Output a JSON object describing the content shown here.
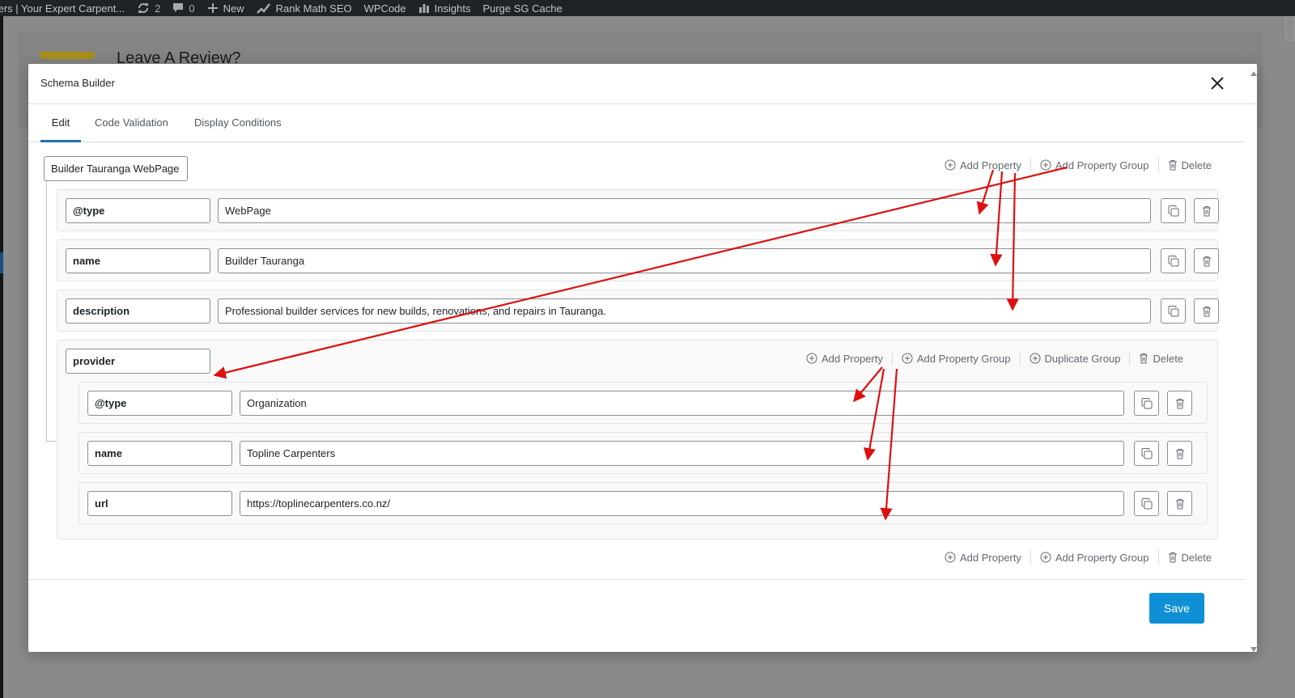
{
  "admin_bar": {
    "site_name": "ters | Your Expert Carpent...",
    "updates_count": "2",
    "comments_count": "0",
    "new_label": "New",
    "rank_math_label": "Rank Math SEO",
    "wpcode_label": "WPCode",
    "insights_label": "Insights",
    "purge_label": "Purge SG Cache"
  },
  "background_page": {
    "title": "Leave A Review?"
  },
  "modal": {
    "title": "Schema Builder",
    "tabs": [
      {
        "label": "Edit",
        "active": true
      },
      {
        "label": "Code Validation",
        "active": false
      },
      {
        "label": "Display Conditions",
        "active": false
      }
    ],
    "save_label": "Save"
  },
  "builder": {
    "group_name": "Builder Tauranga WebPage",
    "toolbar": {
      "add_property": "Add Property",
      "add_property_group": "Add Property Group",
      "delete": "Delete"
    },
    "properties": [
      {
        "key": "@type",
        "value": "WebPage"
      },
      {
        "key": "name",
        "value": "Builder Tauranga"
      },
      {
        "key": "description",
        "value": "Professional builder services for new builds, renovations, and repairs in Tauranga."
      }
    ],
    "nested_group": {
      "key": "provider",
      "toolbar": {
        "add_property": "Add Property",
        "add_property_group": "Add Property Group",
        "duplicate_group": "Duplicate Group",
        "delete": "Delete"
      },
      "properties": [
        {
          "key": "@type",
          "value": "Organization"
        },
        {
          "key": "name",
          "value": "Topline Carpenters"
        },
        {
          "key": "url",
          "value": "https://toplinecarpenters.co.nz/"
        }
      ]
    },
    "bottom_toolbar": {
      "add_property": "Add Property",
      "add_property_group": "Add Property Group",
      "delete": "Delete"
    }
  },
  "colors": {
    "accent": "#2271b1",
    "save_button": "#0f8fd6",
    "annotation_arrows": "#dd1111",
    "admin_bar": "#1d2327"
  },
  "icons": [
    "refresh-icon",
    "comment-icon",
    "plus-icon",
    "rank-math-icon",
    "insights-icon",
    "close-icon",
    "circle-plus-icon",
    "trash-icon",
    "duplicate-icon"
  ]
}
